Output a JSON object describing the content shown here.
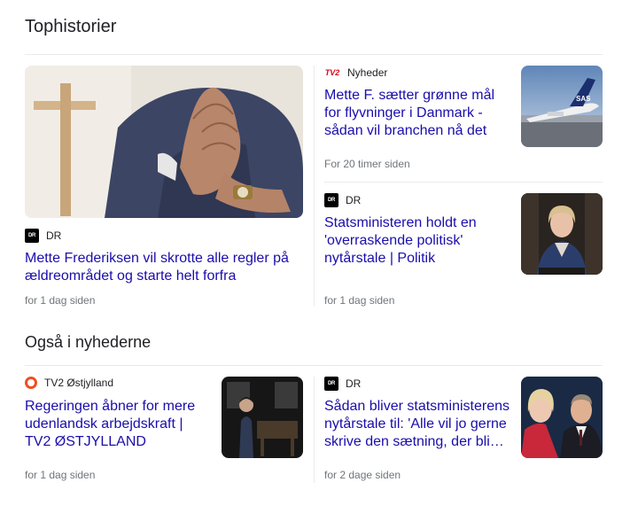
{
  "sections": {
    "top": "Tophistorier",
    "also": "Også i nyhederne"
  },
  "stories": {
    "main": {
      "source": "DR",
      "headline": "Mette Frederiksen vil skrotte alle regler på ældreområdet og starte helt forfra",
      "time": "for 1 dag siden"
    },
    "flight": {
      "source": "Nyheder",
      "headline": "Mette F. sætter grønne mål for flyvninger i Danmark - sådan vil branchen nå det",
      "time": "For 20 timer siden"
    },
    "statsminister": {
      "source": "DR",
      "headline": "Statsministeren holdt en 'overraskende politisk' nytårstale | Politik",
      "time": "for 1 dag siden"
    },
    "tv2": {
      "source": "TV2 Østjylland",
      "headline": "Regeringen åbner for mere udenlandsk arbejdskraft | TV2 ØSTJYLLAND",
      "time": "for 1 dag siden"
    },
    "nytaar": {
      "source": "DR",
      "headline": "Sådan bliver statsministerens nytårstale til: 'Alle vil jo gerne skrive den sætning, der bli…",
      "time": "for 2 dage siden"
    }
  },
  "logos": {
    "dr": "DR",
    "tv2": "TV2"
  },
  "colors": {
    "link": "#1a0dab",
    "meta": "#70757a",
    "tv2_red": "#d9001b",
    "tv2_ostjylland_orange": "#f04e23"
  }
}
